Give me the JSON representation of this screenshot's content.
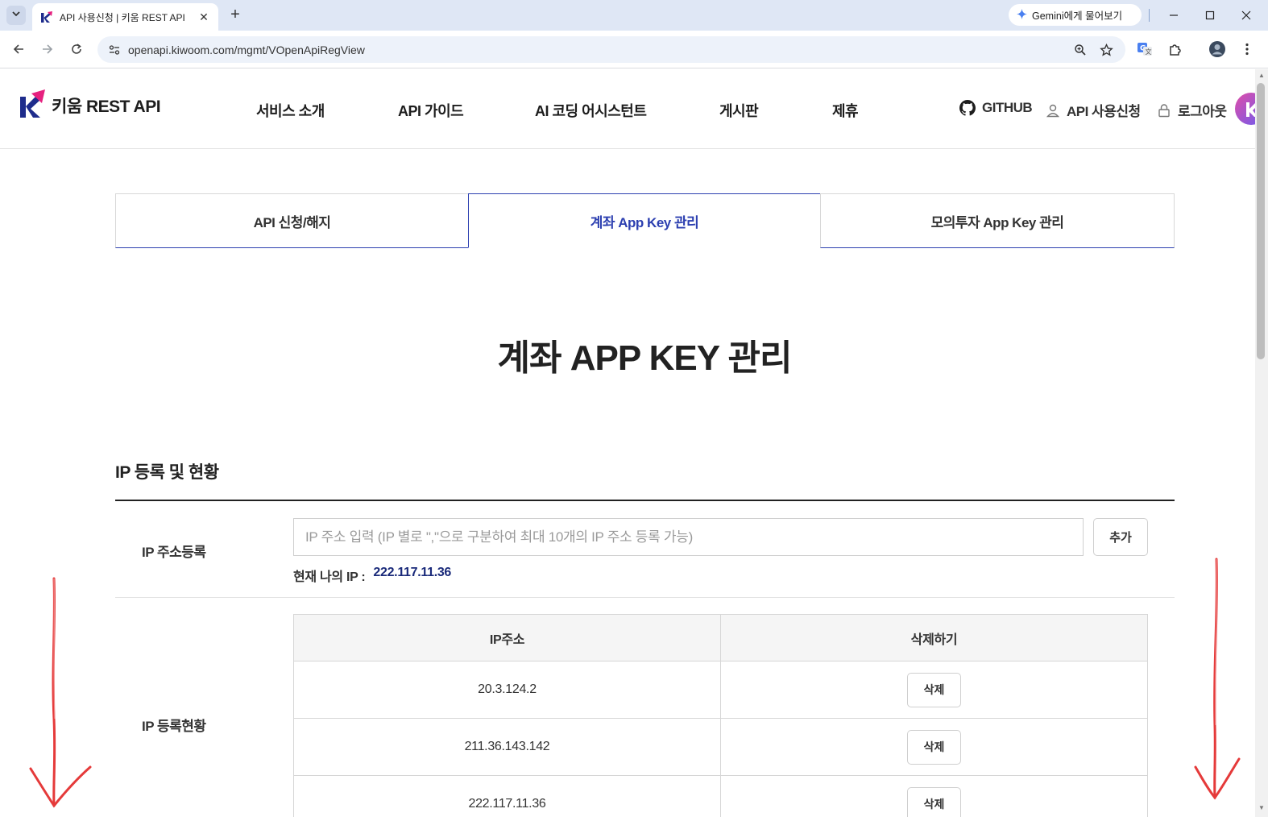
{
  "browser": {
    "tab_title": "API 사용신청 | 키움 REST API",
    "tab_close": "✕",
    "new_tab": "+",
    "gemini_label": "Gemini에게 물어보기",
    "url": "openapi.kiwoom.com/mgmt/VOpenApiRegView"
  },
  "header": {
    "logo_text": "키움 REST API",
    "nav": [
      "서비스 소개",
      "API 가이드",
      "AI 코딩 어시스턴트",
      "게시판",
      "제휴"
    ],
    "util": {
      "github": "GITHUB",
      "api_apply": "API 사용신청",
      "logout": "로그아웃"
    }
  },
  "tabs": [
    {
      "label": "API 신청/해지",
      "active": false
    },
    {
      "label": "계좌 App Key 관리",
      "active": true
    },
    {
      "label": "모의투자 App Key 관리",
      "active": false
    }
  ],
  "page_title": "계좌 APP KEY 관리",
  "ip_section": {
    "title": "IP 등록 및 현황",
    "register_label": "IP 주소등록",
    "input_placeholder": "IP 주소 입력 (IP 별로 \",\"으로 구분하여 최대 10개의 IP 주소 등록 가능)",
    "input_value": "",
    "add_button": "추가",
    "my_ip_label": "현재 나의 IP :",
    "my_ip_value": "222.117.11.36",
    "status_label": "IP 등록현황",
    "table": {
      "headers": [
        "IP주소",
        "삭제하기"
      ],
      "rows": [
        {
          "ip": "20.3.124.2",
          "action": "삭제"
        },
        {
          "ip": "211.36.143.142",
          "action": "삭제"
        },
        {
          "ip": "222.117.11.36",
          "action": "삭제"
        }
      ]
    }
  },
  "colors": {
    "accent": "#2c3fb0",
    "ip_value": "#1a2a7a",
    "logo_pink": "#e6217f",
    "logo_navy": "#1e2c8c",
    "annotation_red": "#e53a3a"
  }
}
